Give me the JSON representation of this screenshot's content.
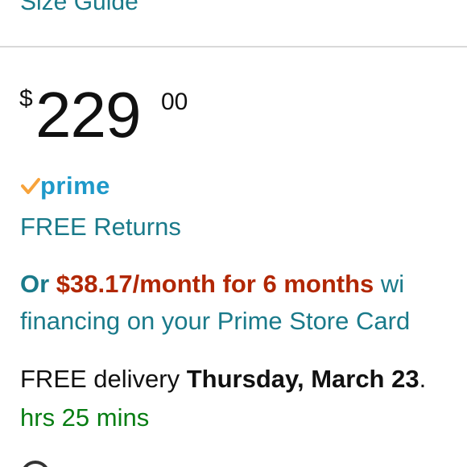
{
  "size_guide_link": "Size Guide",
  "price": {
    "currency_symbol": "$",
    "whole": "229",
    "fraction": "00"
  },
  "prime_badge": {
    "icon": "check-icon",
    "label": "prime",
    "color": "#1e99c9",
    "check_color": "#f7a33b"
  },
  "free_returns_link": "FREE Returns",
  "financing": {
    "prefix": "Or ",
    "offer": "$38.17/month for 6 months",
    "suffix": " wi",
    "line2": "financing on your Prime Store Card"
  },
  "delivery": {
    "prefix": "FREE delivery ",
    "date": "Thursday, March 23",
    "suffix": ". "
  },
  "countdown": "hrs 25 mins",
  "colors": {
    "link": "#1a7a8a",
    "offer_red": "#b12704",
    "countdown_green": "#067d12"
  }
}
